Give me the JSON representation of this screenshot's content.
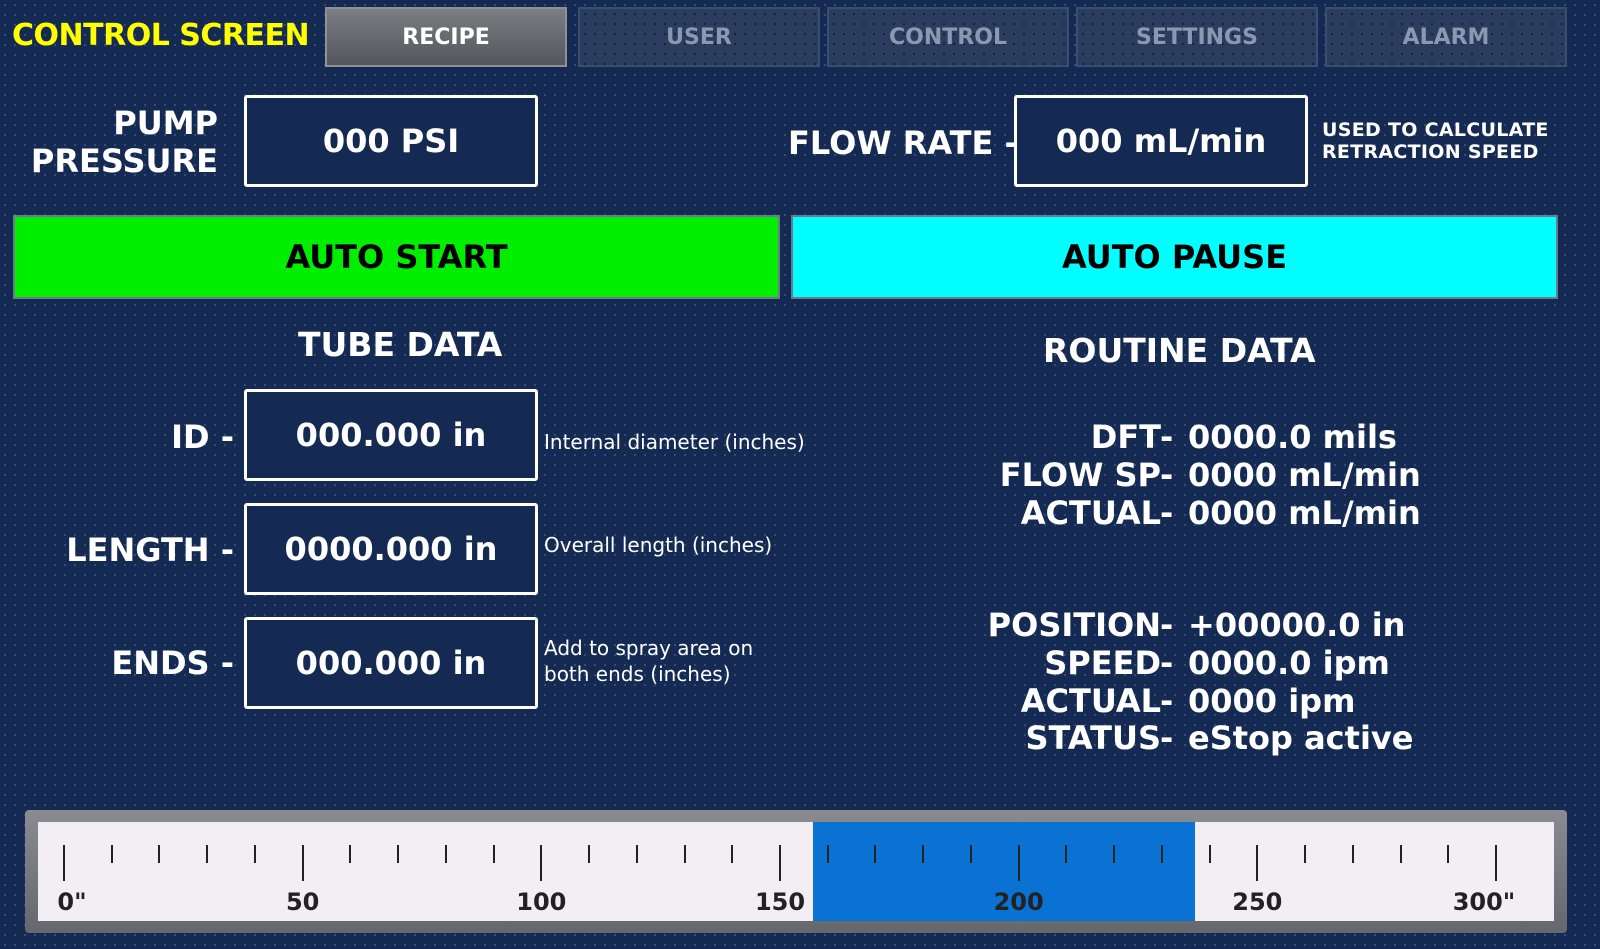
{
  "header": {
    "title": "CONTROL SCREEN",
    "tabs": [
      {
        "label": "RECIPE",
        "active": true
      },
      {
        "label": "USER",
        "active": false
      },
      {
        "label": "CONTROL",
        "active": false
      },
      {
        "label": "SETTINGS",
        "active": false
      },
      {
        "label": "ALARM",
        "active": false
      }
    ]
  },
  "pump": {
    "label_line1": "PUMP",
    "label_line2": "PRESSURE",
    "value": "000 PSI"
  },
  "flow": {
    "label": "FLOW RATE -",
    "value": "000 mL/min",
    "note_line1": "USED TO CALCULATE",
    "note_line2": "RETRACTION SPEED"
  },
  "buttons": {
    "auto_start": "AUTO START",
    "auto_pause": "AUTO PAUSE",
    "auto_start_color": "#00ee00",
    "auto_pause_color": "#00ffff"
  },
  "tube": {
    "title": "TUBE DATA",
    "id": {
      "label": "ID -",
      "value": "000.000 in",
      "note_line1": "Internal diameter (inches)",
      "note_line2": ""
    },
    "length": {
      "label": "LENGTH -",
      "value": "0000.000 in",
      "note_line1": "Overall length (inches)",
      "note_line2": ""
    },
    "ends": {
      "label": "ENDS -",
      "value": "000.000 in",
      "note_line1": "Add to spray area on",
      "note_line2": "both ends (inches)"
    }
  },
  "routine": {
    "title": "ROUTINE DATA",
    "group1": [
      {
        "key": "DFT",
        "value": "0000.0 mils"
      },
      {
        "key": "FLOW SP",
        "value": "0000 mL/min"
      },
      {
        "key": "ACTUAL",
        "value": "0000 mL/min"
      }
    ],
    "group2": [
      {
        "key": "POSITION",
        "value": "+00000.0 in"
      },
      {
        "key": "SPEED",
        "value": "0000.0 ipm"
      },
      {
        "key": "ACTUAL",
        "value": "0000 ipm"
      },
      {
        "key": "STATUS",
        "value": "eStop active"
      }
    ],
    "dash": "-"
  },
  "scale": {
    "min": 0,
    "max": 300,
    "major_step": 50,
    "minor_step": 10,
    "highlight_start": 157,
    "highlight_end": 237,
    "highlight_color": "#0a72d2",
    "labels": [
      "0\"",
      "50",
      "100",
      "150",
      "200",
      "250",
      "300\""
    ]
  }
}
